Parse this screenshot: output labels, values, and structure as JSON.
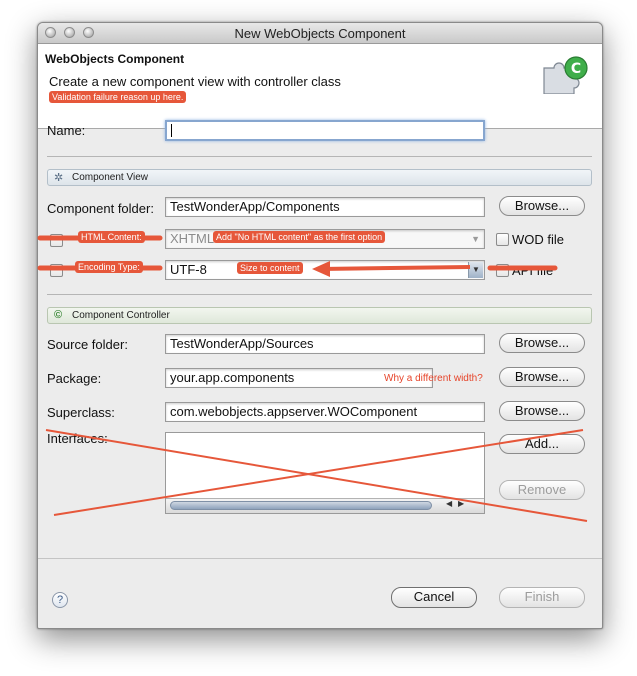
{
  "window": {
    "title": "New WebObjects Component"
  },
  "header": {
    "title": "WebObjects Component",
    "description": "Create a new component view with controller class",
    "annotation": "Validation failure reason up here."
  },
  "name": {
    "label": "Name:",
    "value": ""
  },
  "component_view": {
    "section_label": "Component View",
    "folder_label": "Component folder:",
    "folder_value": "TestWonderApp/Components",
    "browse_label": "Browse...",
    "html_value": "XHTML 1",
    "html_annotation": "HTML Content:",
    "html_note": "Add \"No HTML content\" as the first option",
    "wod_label": "WOD file",
    "encoding_annotation": "Encoding Type:",
    "encoding_value": "UTF-8",
    "encoding_note": "Size to content",
    "api_label": "API file"
  },
  "component_controller": {
    "section_label": "Component Controller",
    "source_label": "Source folder:",
    "source_value": "TestWonderApp/Sources",
    "package_label": "Package:",
    "package_value": "your.app.components",
    "package_note": "Why a different width?",
    "superclass_label": "Superclass:",
    "superclass_value": "com.webobjects.appserver.WOComponent",
    "interfaces_label": "Interfaces:",
    "add_label": "Add...",
    "remove_label": "Remove",
    "browse_label": "Browse..."
  },
  "footer": {
    "help_icon": "?",
    "cancel_label": "Cancel",
    "finish_label": "Finish"
  },
  "colors": {
    "annotation": "#e6573a",
    "window_bg": "#ececec"
  }
}
